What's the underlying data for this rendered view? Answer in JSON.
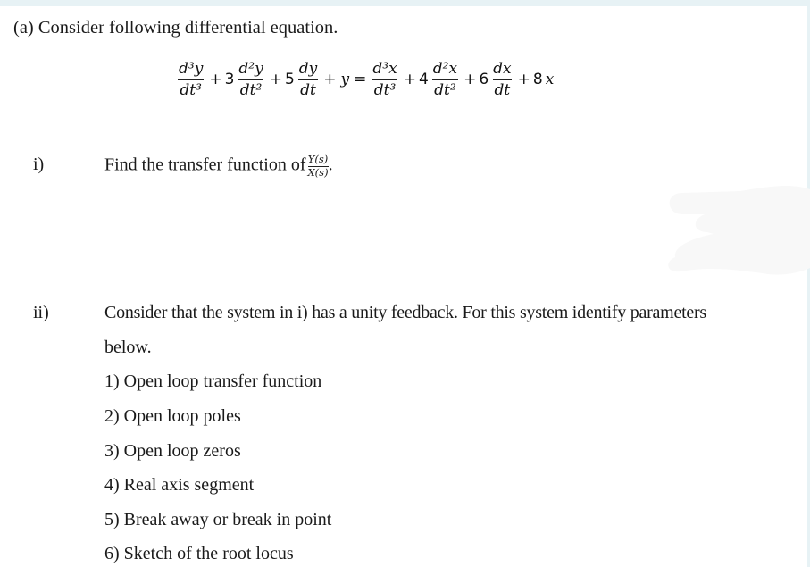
{
  "document": {
    "heading": "(a) Consider following differential equation.",
    "equation": {
      "lhs": [
        {
          "type": "frac",
          "num": "d³y",
          "den": "dt³"
        },
        {
          "type": "op",
          "text": "+"
        },
        {
          "type": "coef",
          "text": "3"
        },
        {
          "type": "frac",
          "num": "d²y",
          "den": "dt²"
        },
        {
          "type": "op",
          "text": "+"
        },
        {
          "type": "coef",
          "text": "5"
        },
        {
          "type": "frac",
          "num": "dy",
          "den": "dt"
        },
        {
          "type": "op",
          "text": "+"
        },
        {
          "type": "var",
          "text": "y"
        }
      ],
      "equals": "=",
      "rhs": [
        {
          "type": "frac",
          "num": "d³x",
          "den": "dt³"
        },
        {
          "type": "op",
          "text": "+"
        },
        {
          "type": "coef",
          "text": "4"
        },
        {
          "type": "frac",
          "num": "d²x",
          "den": "dt²"
        },
        {
          "type": "op",
          "text": "+"
        },
        {
          "type": "coef",
          "text": "6"
        },
        {
          "type": "frac",
          "num": "dx",
          "den": "dt"
        },
        {
          "type": "op",
          "text": "+"
        },
        {
          "type": "coef",
          "text": "8"
        },
        {
          "type": "var",
          "text": "x"
        }
      ]
    },
    "part_i": {
      "label": "i)",
      "text": "Find the transfer function of",
      "frac_num": "Y(s)",
      "frac_den": "X(s)",
      "trailing": "."
    },
    "part_ii": {
      "label": "ii)",
      "text_line1": "Consider that the system in i) has a unity feedback. For this system identify parameters",
      "text_line2": "below.",
      "items": [
        "1) Open loop transfer function",
        "2) Open loop poles",
        "3) Open loop zeros",
        "4) Real axis segment",
        "5) Break away or break in point",
        "6) Sketch of the root locus"
      ]
    },
    "colors": {
      "frame": "#e7f2f5",
      "smudge": "#f8f8f8",
      "text": "#1a1a1a"
    }
  }
}
